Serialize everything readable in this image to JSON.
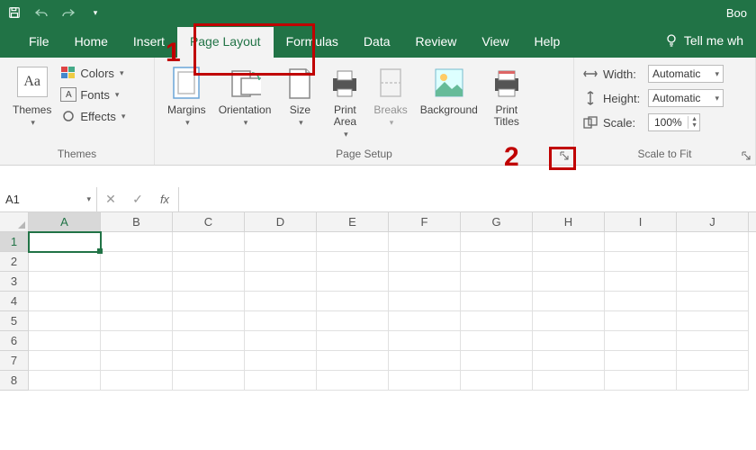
{
  "titlebar": {
    "title": "Boo"
  },
  "tabs": [
    "File",
    "Home",
    "Insert",
    "Page Layout",
    "Formulas",
    "Data",
    "Review",
    "View",
    "Help"
  ],
  "active_tab": "Page Layout",
  "tell_me": "Tell me wh",
  "ribbon": {
    "themes": {
      "group_label": "Themes",
      "themes_btn": "Themes",
      "colors": "Colors",
      "fonts": "Fonts",
      "effects": "Effects"
    },
    "page_setup": {
      "group_label": "Page Setup",
      "margins": "Margins",
      "orientation": "Orientation",
      "size": "Size",
      "print_area": "Print\nArea",
      "breaks": "Breaks",
      "background": "Background",
      "print_titles": "Print\nTitles"
    },
    "scale_to_fit": {
      "group_label": "Scale to Fit",
      "width_label": "Width:",
      "width_value": "Automatic",
      "height_label": "Height:",
      "height_value": "Automatic",
      "scale_label": "Scale:",
      "scale_value": "100%"
    }
  },
  "formula_bar": {
    "name_box": "A1",
    "fx": "fx"
  },
  "grid": {
    "columns": [
      "A",
      "B",
      "C",
      "D",
      "E",
      "F",
      "G",
      "H",
      "I",
      "J"
    ],
    "rows": [
      1,
      2,
      3,
      4,
      5,
      6,
      7,
      8
    ],
    "selected_cell": "A1"
  },
  "annotations": {
    "label1": "1",
    "label2": "2"
  }
}
